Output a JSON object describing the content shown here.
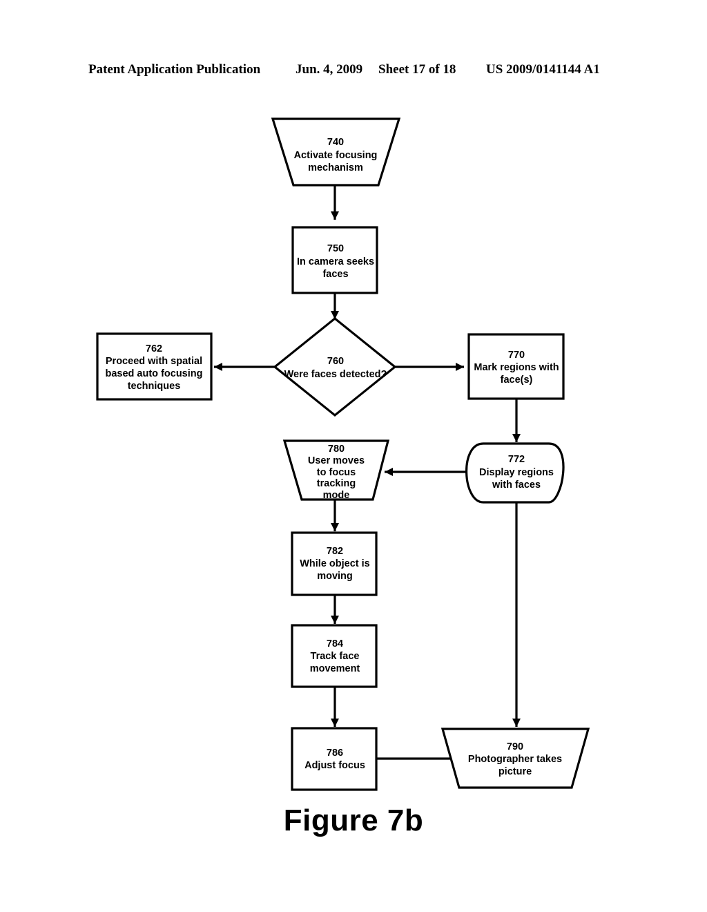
{
  "header": {
    "publication": "Patent Application Publication",
    "date": "Jun. 4, 2009",
    "sheet": "Sheet 17 of 18",
    "patent_number": "US 2009/0141144 A1"
  },
  "figure": {
    "caption": "Figure 7b"
  },
  "colors": {
    "stroke": "#000000",
    "fill": "#ffffff",
    "text": "#000000"
  },
  "chart_data": {
    "type": "diagram",
    "title": "Figure 7b",
    "nodes": [
      {
        "id": "740",
        "shape": "trapezoid-inverted",
        "number": "740",
        "lines": [
          "740",
          "Activate focusing",
          "mechanism"
        ]
      },
      {
        "id": "750",
        "shape": "rectangle",
        "number": "750",
        "lines": [
          "750",
          "In camera seeks",
          "faces"
        ]
      },
      {
        "id": "760",
        "shape": "diamond",
        "number": "760",
        "lines": [
          "760",
          "Were faces detected?"
        ]
      },
      {
        "id": "762",
        "shape": "rectangle",
        "number": "762",
        "lines": [
          "762",
          "Proceed with spatial",
          "based auto focusing",
          "techniques"
        ]
      },
      {
        "id": "770",
        "shape": "rectangle",
        "number": "770",
        "lines": [
          "770",
          "Mark regions with",
          "face(s)"
        ]
      },
      {
        "id": "772",
        "shape": "oval",
        "number": "772",
        "lines": [
          "772",
          "Display regions",
          "with faces"
        ]
      },
      {
        "id": "780",
        "shape": "trapezoid-inverted",
        "number": "780",
        "lines": [
          "780",
          "User moves",
          "to focus",
          "tracking",
          "mode"
        ]
      },
      {
        "id": "782",
        "shape": "rectangle",
        "number": "782",
        "lines": [
          "782",
          "While object is",
          "moving"
        ]
      },
      {
        "id": "784",
        "shape": "rectangle",
        "number": "784",
        "lines": [
          "784",
          "Track face",
          "movement"
        ]
      },
      {
        "id": "786",
        "shape": "rectangle",
        "number": "786",
        "lines": [
          "786",
          "Adjust focus"
        ]
      },
      {
        "id": "790",
        "shape": "trapezoid-inverted",
        "number": "790",
        "lines": [
          "790",
          "Photographer takes",
          "picture"
        ]
      }
    ],
    "edges": [
      {
        "from": "740",
        "to": "750",
        "direction": "down",
        "label": ""
      },
      {
        "from": "750",
        "to": "760",
        "direction": "down",
        "label": ""
      },
      {
        "from": "760",
        "to": "762",
        "direction": "left",
        "label": ""
      },
      {
        "from": "760",
        "to": "770",
        "direction": "right",
        "label": ""
      },
      {
        "from": "770",
        "to": "772",
        "direction": "down",
        "label": ""
      },
      {
        "from": "772",
        "to": "780",
        "direction": "left",
        "label": ""
      },
      {
        "from": "772",
        "to": "790",
        "direction": "down",
        "label": ""
      },
      {
        "from": "780",
        "to": "782",
        "direction": "down",
        "label": ""
      },
      {
        "from": "782",
        "to": "784",
        "direction": "down",
        "label": ""
      },
      {
        "from": "784",
        "to": "786",
        "direction": "down",
        "label": ""
      },
      {
        "from": "786",
        "to": "790",
        "direction": "right",
        "label": ""
      }
    ]
  },
  "node_text": {
    "n740": {
      "l0": "740",
      "l1": "Activate focusing",
      "l2": "mechanism"
    },
    "n750": {
      "l0": "750",
      "l1": "In camera seeks",
      "l2": "faces"
    },
    "n760": {
      "l0": "760",
      "l1": "Were faces detected?"
    },
    "n762": {
      "l0": "762",
      "l1": "Proceed with spatial",
      "l2": "based auto focusing",
      "l3": "techniques"
    },
    "n770": {
      "l0": "770",
      "l1": "Mark regions with",
      "l2": "face(s)"
    },
    "n772": {
      "l0": "772",
      "l1": "Display regions",
      "l2": "with faces"
    },
    "n780": {
      "l0": "780",
      "l1": "User moves",
      "l2": "to focus",
      "l3": "tracking",
      "l4": "mode"
    },
    "n782": {
      "l0": "782",
      "l1": "While object is",
      "l2": "moving"
    },
    "n784": {
      "l0": "784",
      "l1": "Track face",
      "l2": "movement"
    },
    "n786": {
      "l0": "786",
      "l1": "Adjust focus"
    },
    "n790": {
      "l0": "790",
      "l1": "Photographer takes",
      "l2": "picture"
    }
  }
}
